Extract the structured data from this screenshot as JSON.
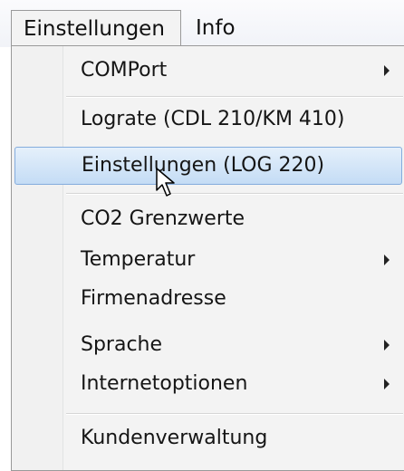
{
  "menubar": {
    "items": [
      {
        "label": "Einstellungen"
      },
      {
        "label": "Info"
      }
    ]
  },
  "dropdown": {
    "items": [
      {
        "label": "COMPort",
        "has_submenu": true
      },
      {
        "label": "Lograte (CDL 210/KM 410)",
        "has_submenu": false
      },
      {
        "label": "Einstellungen (LOG 220)",
        "has_submenu": false,
        "highlighted": true
      },
      {
        "label": "CO2 Grenzwerte",
        "has_submenu": false
      },
      {
        "label": "Temperatur",
        "has_submenu": true
      },
      {
        "label": "Firmenadresse",
        "has_submenu": false
      },
      {
        "label": "Sprache",
        "has_submenu": true
      },
      {
        "label": "Internetoptionen",
        "has_submenu": true
      },
      {
        "label": "Kundenverwaltung",
        "has_submenu": false
      }
    ]
  },
  "colors": {
    "highlight_border": "#84acdd",
    "highlight_fill": "#c4dcf5"
  },
  "icons": {
    "submenu": "submenu-arrow-icon",
    "cursor": "mouse-pointer-icon"
  }
}
